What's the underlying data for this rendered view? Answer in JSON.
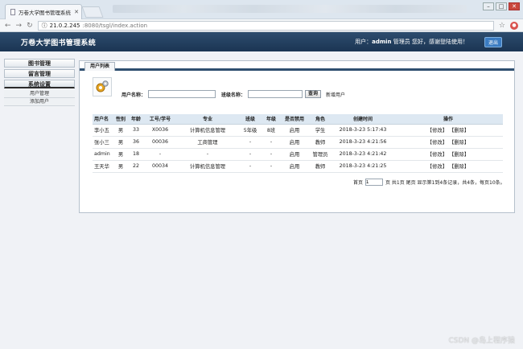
{
  "browser": {
    "tab_title": "万卷大学图书管理系统",
    "url_host": "21.0.2.245",
    "url_path": ":8080/tsgl/index.action"
  },
  "header": {
    "app_title": "万卷大学图书管理系统",
    "user_prefix": "用户：",
    "username": "admin",
    "user_suffix": " 管理员 您好，感谢登陆使用！",
    "logout": "退出"
  },
  "sidebar": {
    "sections": [
      {
        "label": "图书管理"
      },
      {
        "label": "留言管理"
      },
      {
        "label": "系统设置"
      }
    ],
    "subitems": [
      {
        "label": "用户管理"
      },
      {
        "label": "添加用户"
      }
    ]
  },
  "panel": {
    "tab": "用户列表",
    "search": {
      "name_label": "用户名称：",
      "class_label": "班级名称：",
      "query": "查询",
      "add": "新增用户"
    },
    "columns": [
      "用户名",
      "性别",
      "年龄",
      "工号/学号",
      "专业",
      "班级",
      "年级",
      "是否禁用",
      "角色",
      "创建时间",
      "操作"
    ],
    "rows": [
      {
        "name": "李小五",
        "sex": "男",
        "age": "33",
        "id": "X0036",
        "major": "计算机信息管理",
        "cls": "5年级",
        "grade": "8班",
        "disabled": "启用",
        "role": "学生",
        "created": "2018-3-23 5:17:43",
        "edit": "【修改】",
        "del": "【删除】"
      },
      {
        "name": "张小三",
        "sex": "男",
        "age": "36",
        "id": "00036",
        "major": "工商管理",
        "cls": "-",
        "grade": "-",
        "disabled": "启用",
        "role": "教师",
        "created": "2018-3-23 4:21:56",
        "edit": "【修改】",
        "del": "【删除】"
      },
      {
        "name": "admin",
        "sex": "男",
        "age": "18",
        "id": "-",
        "major": "-",
        "cls": "-",
        "grade": "-",
        "disabled": "启用",
        "role": "管理员",
        "created": "2018-3-23 4:21:42",
        "edit": "【修改】",
        "del": "【删除】"
      },
      {
        "name": "王天华",
        "sex": "男",
        "age": "22",
        "id": "00034",
        "major": "计算机信息管理",
        "cls": "-",
        "grade": "-",
        "disabled": "启用",
        "role": "教师",
        "created": "2018-3-23 4:21:25",
        "edit": "【修改】",
        "del": "【删除】"
      }
    ],
    "pager": {
      "before": "首页",
      "page_value": "1",
      "after": "页 共1页 尾页 显示第1到4条记录，共4条，每页10条。"
    }
  },
  "watermark": "CSDN @岛上程序猿"
}
